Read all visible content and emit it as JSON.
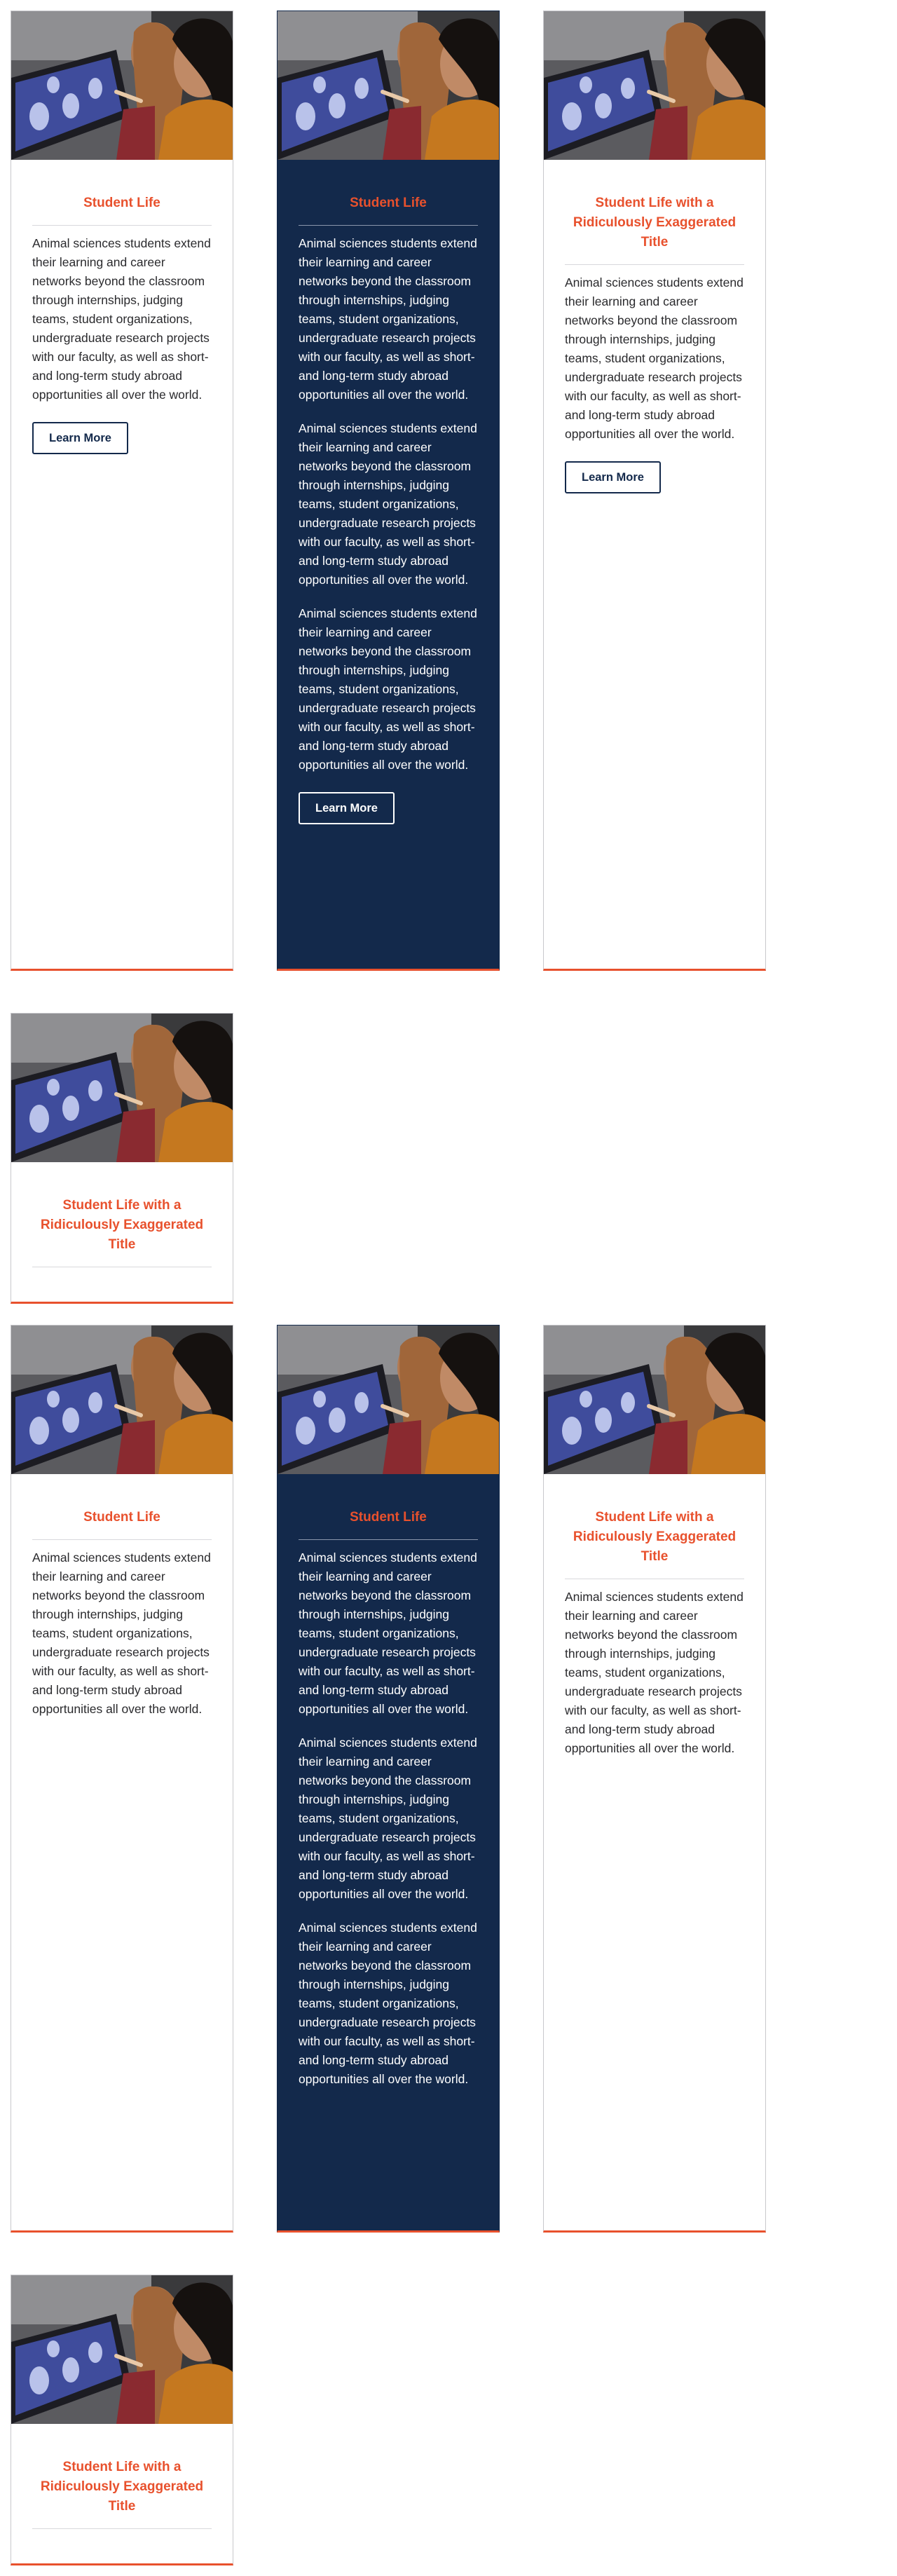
{
  "rows": [
    {
      "cards": [
        {
          "title": "Student Life",
          "paragraphs": [
            "Animal sciences students extend their learning and career networks beyond the classroom through internships, judging teams, student organizations, undergraduate research projects with our faculty, as well as short- and long-term study abroad opportunities all over the world."
          ],
          "button": "Learn More"
        },
        {
          "title": "Student Life",
          "paragraphs": [
            "Animal sciences students extend their learning and career networks beyond the classroom through internships, judging teams, student organizations, undergraduate research projects with our faculty, as well as short- and long-term study abroad opportunities all over the world.",
            "Animal sciences students extend their learning and career networks beyond the classroom through internships, judging teams, student organizations, undergraduate research projects with our faculty, as well as short- and long-term study abroad opportunities all over the world.",
            "Animal sciences students extend their learning and career networks beyond the classroom through internships, judging teams, student organizations, undergraduate research projects with our faculty, as well as short- and long-term study abroad opportunities all over the world."
          ],
          "button": "Learn More"
        },
        {
          "title": "Student Life with a Ridiculously Exaggerated Title",
          "paragraphs": [
            "Animal sciences students extend their learning and career networks beyond the classroom through internships, judging teams, student organizations, undergraduate research projects with our faculty, as well as short- and long-term study abroad opportunities all over the world."
          ],
          "button": "Learn More"
        }
      ]
    },
    {
      "cards": [
        {
          "title": "Student Life with a Ridiculously Exaggerated Title"
        }
      ]
    },
    {
      "cards": [
        {
          "title": "Student Life",
          "paragraphs": [
            "Animal sciences students extend their learning and career networks beyond the classroom through internships, judging teams, student organizations, undergraduate research projects with our faculty, as well as short- and long-term study abroad opportunities all over the world."
          ]
        },
        {
          "title": "Student Life",
          "paragraphs": [
            "Animal sciences students extend their learning and career networks beyond the classroom through internships, judging teams, student organizations, undergraduate research projects with our faculty, as well as short- and long-term study abroad opportunities all over the world.",
            "Animal sciences students extend their learning and career networks beyond the classroom through internships, judging teams, student organizations, undergraduate research projects with our faculty, as well as short- and long-term study abroad opportunities all over the world.",
            "Animal sciences students extend their learning and career networks beyond the classroom through internships, judging teams, student organizations, undergraduate research projects with our faculty, as well as short- and long-term study abroad opportunities all over the world."
          ]
        },
        {
          "title": "Student Life with a Ridiculously Exaggerated Title",
          "paragraphs": [
            "Animal sciences students extend their learning and career networks beyond the classroom through internships, judging teams, student organizations, undergraduate research projects with our faculty, as well as short- and long-term study abroad opportunities all over the world."
          ]
        }
      ]
    },
    {
      "cards": [
        {
          "title": "Student Life with a Ridiculously Exaggerated Title"
        }
      ]
    }
  ],
  "colors": {
    "accent": "#e8512d",
    "navy": "#13294b",
    "border": "#c8c8cc"
  }
}
